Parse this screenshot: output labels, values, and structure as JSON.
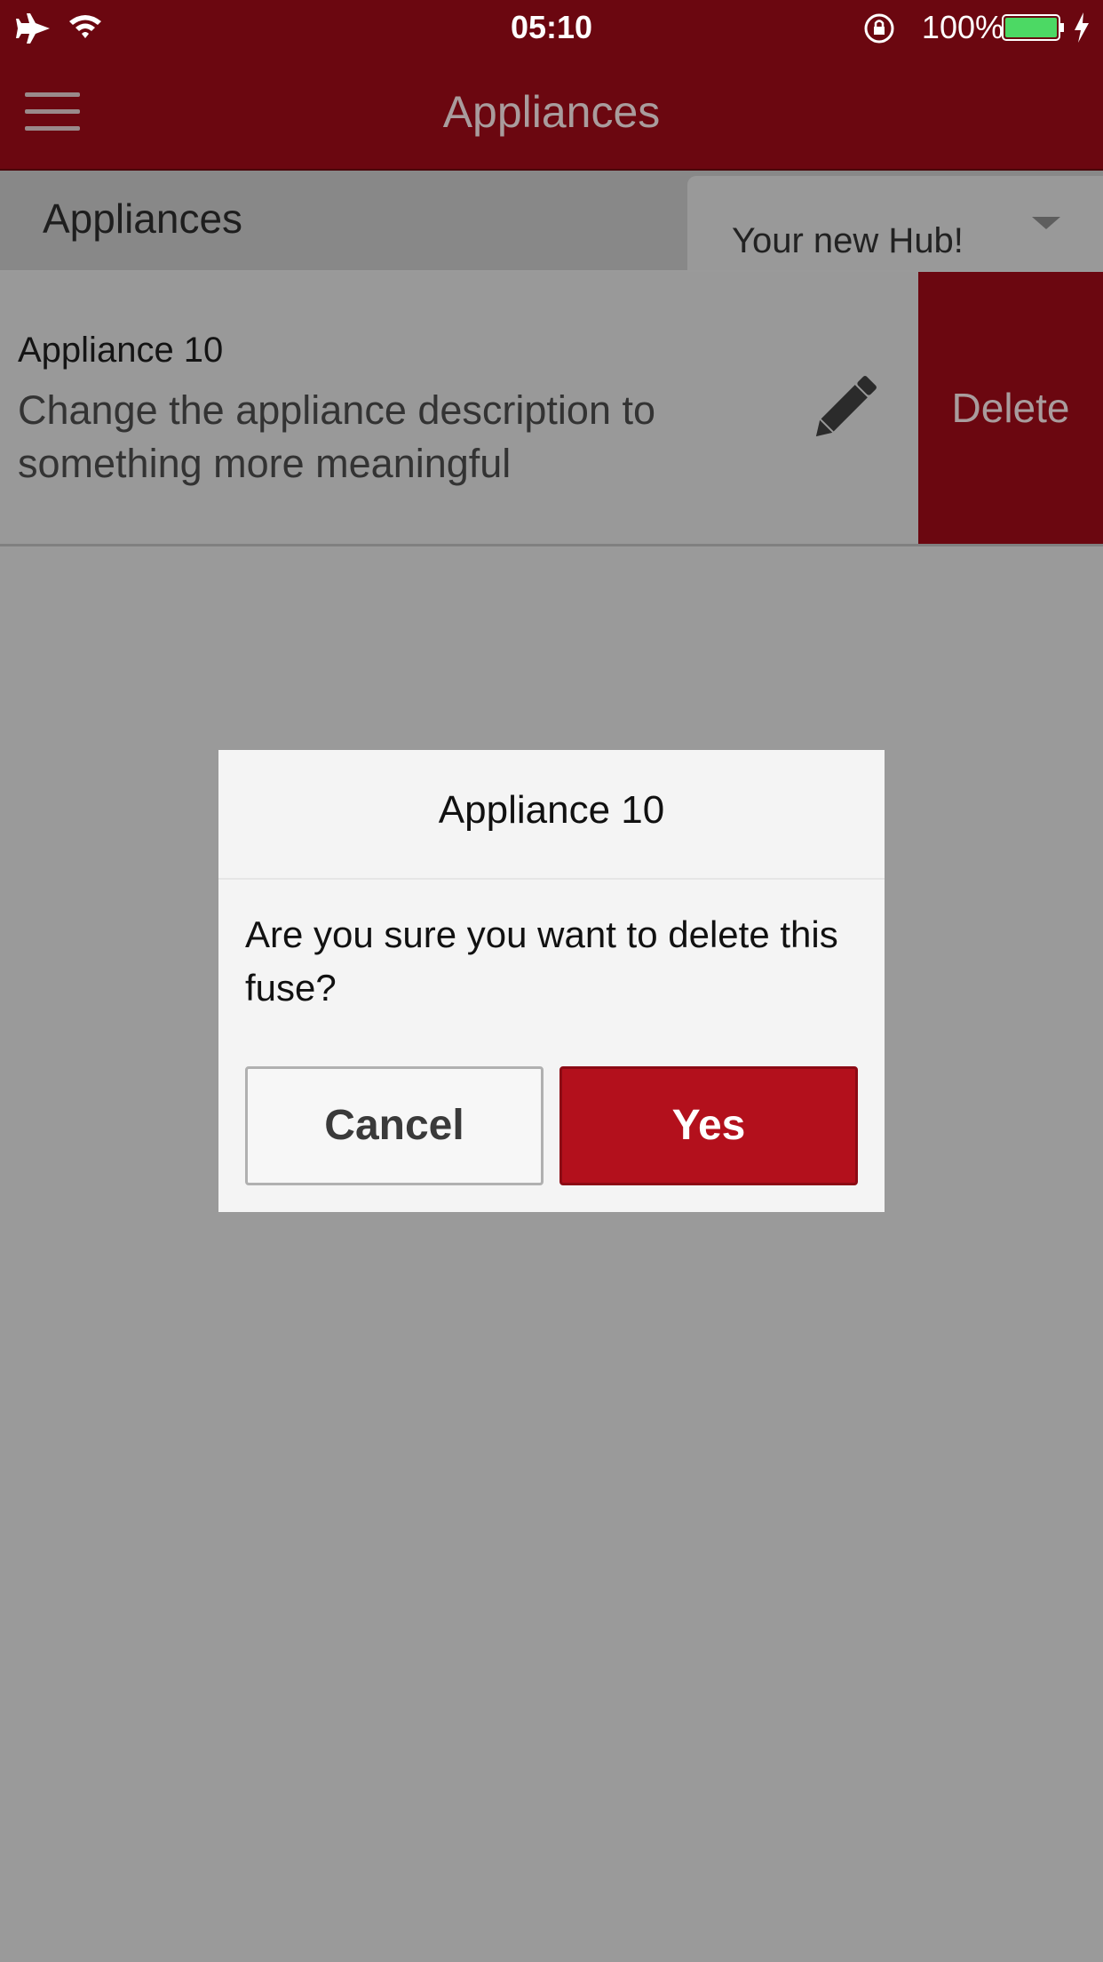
{
  "status_bar": {
    "time": "05:10",
    "battery_percent": "100%"
  },
  "navbar": {
    "title": "Appliances"
  },
  "section": {
    "title": "Appliances",
    "hub_select_value": "Your new Hub!"
  },
  "appliance": {
    "name": "Appliance 10",
    "description": "Change the appliance description to something more meaningful",
    "delete_label": "Delete"
  },
  "dialog": {
    "title": "Appliance 10",
    "message": "Are you sure you want to delete this fuse?",
    "cancel_label": "Cancel",
    "confirm_label": "Yes"
  },
  "colors": {
    "brand_red": "#b3101c",
    "dimmed_red": "#6b0710",
    "overlay_gray": "#9a9a9a",
    "battery_green": "#4cd964"
  },
  "icons": {
    "airplane": "airplane-mode-icon",
    "wifi": "wifi-icon",
    "rotation_lock": "rotation-lock-icon",
    "battery": "battery-icon",
    "charging": "charging-bolt-icon",
    "menu": "hamburger-menu-icon",
    "dropdown": "chevron-down-icon",
    "edit": "pencil-icon"
  }
}
